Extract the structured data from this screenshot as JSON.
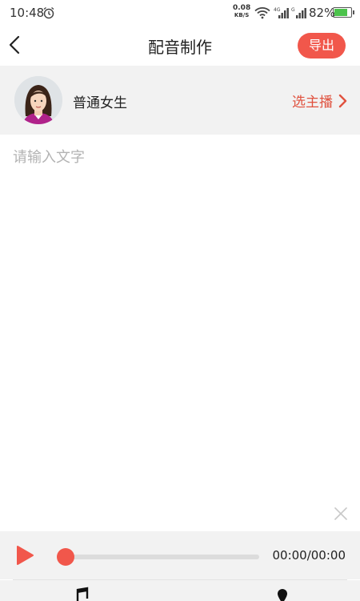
{
  "status_bar": {
    "time": "10:48",
    "net_speed": "0.08",
    "net_speed_unit": "KB/S",
    "battery_percent": "82%",
    "icons": [
      "alarm-icon",
      "wifi-icon",
      "signal-4g-icon",
      "signal-g-icon",
      "battery-icon"
    ]
  },
  "header": {
    "title": "配音制作",
    "export_label": "导出"
  },
  "voice": {
    "name": "普通女生",
    "choose_label": "选主播"
  },
  "editor": {
    "placeholder": "请输入文字",
    "value": ""
  },
  "player": {
    "time": "00:00/00:00",
    "progress": 0
  },
  "colors": {
    "accent": "#f1574b",
    "accent_text": "#e0523f",
    "panel_bg": "#f2f2f2",
    "placeholder": "#b3b3b3"
  }
}
